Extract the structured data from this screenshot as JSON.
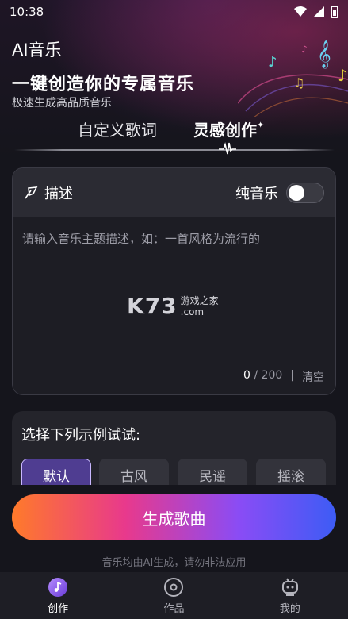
{
  "status_bar": {
    "time": "10:38"
  },
  "app_title": "AI音乐",
  "headline": "一键创造你的专属音乐",
  "subheadline": "极速生成高品质音乐",
  "tabs": [
    {
      "label": "自定义歌词",
      "active": false
    },
    {
      "label": "灵感创作",
      "active": true
    }
  ],
  "description_card": {
    "title": "描述",
    "pure_music_label": "纯音乐",
    "pure_music_on": false,
    "placeholder": "请输入音乐主题描述，如：一首风格为流行的",
    "count_current": "0",
    "count_max": "/ 200",
    "clear_label": "清空",
    "separator": "|"
  },
  "watermark": {
    "logo": "K73",
    "line1": "游戏之家",
    "line2": ".com"
  },
  "examples": {
    "title": "选择下列示例试试:",
    "chips": [
      {
        "label": "默认",
        "active": true
      },
      {
        "label": "古风",
        "active": false
      },
      {
        "label": "民谣",
        "active": false
      },
      {
        "label": "摇滚",
        "active": false
      }
    ]
  },
  "generate_button": "生成歌曲",
  "disclaimer": "音乐均由AI生成，请勿非法应用",
  "bottom_nav": [
    {
      "label": "创作",
      "icon": "music-disc-icon",
      "active": true
    },
    {
      "label": "作品",
      "icon": "record-icon",
      "active": false
    },
    {
      "label": "我的",
      "icon": "robot-profile-icon",
      "active": false
    }
  ],
  "colors": {
    "accent": "#4f3d91",
    "gradient_start": "#ff7a2a",
    "gradient_mid": "#e8398c",
    "gradient_end": "#3d5cf5"
  }
}
